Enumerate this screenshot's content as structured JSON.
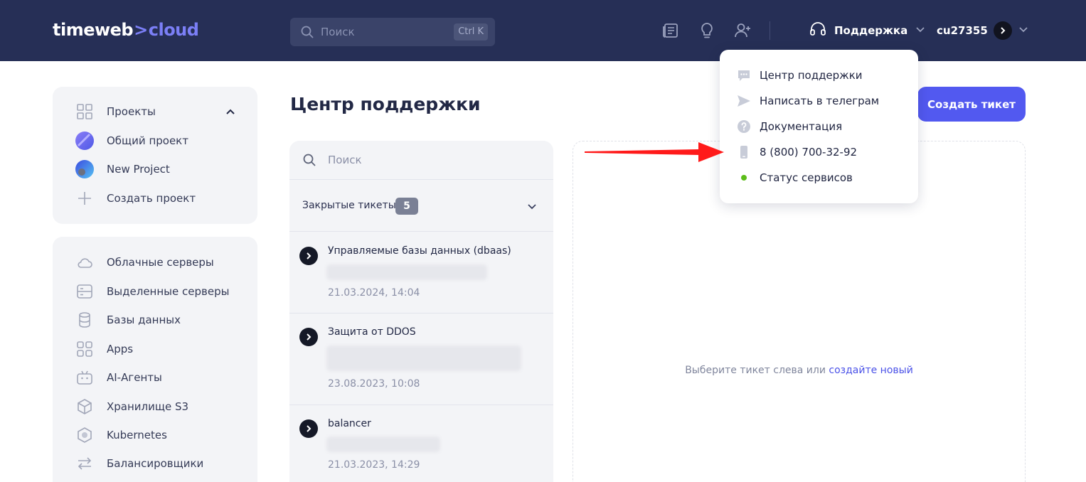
{
  "header": {
    "logo_main": "timeweb",
    "logo_arrow": ">",
    "logo_accent": "cloud",
    "search_placeholder": "Поиск",
    "search_shortcut": "Ctrl K",
    "support_label": "Поддержка",
    "username": "cu27355",
    "icons": [
      "news-icon",
      "lightbulb-icon",
      "add-user-icon",
      "headset-icon"
    ]
  },
  "sidebar": {
    "projects": {
      "title": "Проекты",
      "items": [
        {
          "label": "Общий проект",
          "icon": "project-avatar-icon"
        },
        {
          "label": "New Project",
          "icon": "project-avatar-icon"
        },
        {
          "label": "Создать проект",
          "icon": "plus-icon"
        }
      ]
    },
    "nav": [
      {
        "label": "Облачные серверы",
        "icon": "cloud-icon"
      },
      {
        "label": "Выделенные серверы",
        "icon": "server-icon"
      },
      {
        "label": "Базы данных",
        "icon": "database-icon"
      },
      {
        "label": "Apps",
        "icon": "apps-grid-icon"
      },
      {
        "label": "AI-Агенты",
        "icon": "robot-icon"
      },
      {
        "label": "Хранилище S3",
        "icon": "cube-icon"
      },
      {
        "label": "Kubernetes",
        "icon": "kubernetes-icon"
      },
      {
        "label": "Балансировщики",
        "icon": "arrows-swap-icon"
      }
    ]
  },
  "main": {
    "title": "Центр поддержки",
    "create_button": "Создать тикет",
    "search_placeholder": "Поиск",
    "closed_label": "Закрытые тикеты",
    "closed_count": "5",
    "tickets": [
      {
        "title": "Управляемые базы данных (dbaas)",
        "date": "21.03.2024, 14:04"
      },
      {
        "title": "Защита от DDOS",
        "date": "23.08.2023, 10:08"
      },
      {
        "title": "balancer",
        "date": "21.03.2023, 14:29"
      }
    ],
    "empty_text": "Выберите тикет слева или",
    "empty_link": "создайте новый"
  },
  "dropdown": {
    "items": [
      {
        "label": "Центр поддержки",
        "icon": "chat-icon"
      },
      {
        "label": "Написать в телеграм",
        "icon": "send-icon"
      },
      {
        "label": "Документация",
        "icon": "question-icon"
      },
      {
        "label": "8 (800) 700-32-92",
        "icon": "phone-icon"
      },
      {
        "label": "Статус сервисов",
        "icon": "status-dot-icon"
      }
    ]
  },
  "colors": {
    "header_bg": "#262f56",
    "accent": "#5259f0",
    "annotation_arrow": "#ff1a1a",
    "status_green": "#5cbd1a"
  }
}
